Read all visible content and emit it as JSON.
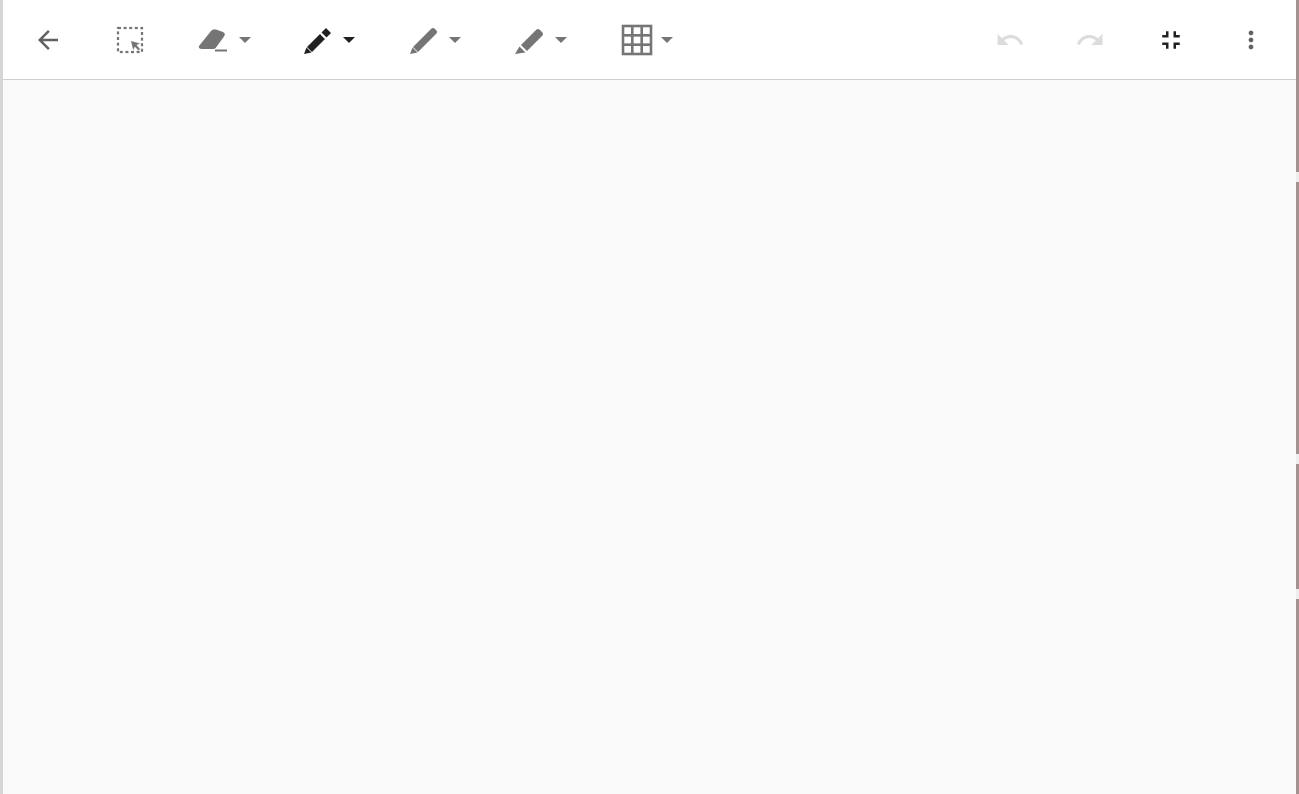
{
  "toolbar": {
    "tools": [
      {
        "name": "back-button",
        "icon": "arrow-left-icon",
        "has_dropdown": false,
        "enabled": true
      },
      {
        "name": "select-tool",
        "icon": "lasso-select-icon",
        "has_dropdown": false,
        "enabled": true
      },
      {
        "name": "eraser-tool",
        "icon": "eraser-icon",
        "has_dropdown": true,
        "enabled": true
      },
      {
        "name": "marker-tool",
        "icon": "marker-icon",
        "has_dropdown": true,
        "enabled": true,
        "active": true
      },
      {
        "name": "pen-tool",
        "icon": "pen-icon",
        "has_dropdown": true,
        "enabled": true
      },
      {
        "name": "highlighter-tool",
        "icon": "highlighter-icon",
        "has_dropdown": true,
        "enabled": true
      },
      {
        "name": "background-tool",
        "icon": "grid-icon",
        "has_dropdown": true,
        "enabled": true
      },
      {
        "name": "undo-button",
        "icon": "undo-icon",
        "has_dropdown": false,
        "enabled": false
      },
      {
        "name": "redo-button",
        "icon": "redo-icon",
        "has_dropdown": false,
        "enabled": false
      },
      {
        "name": "exit-fullscreen-button",
        "icon": "fullscreen-exit-icon",
        "has_dropdown": false,
        "enabled": true
      },
      {
        "name": "more-options-button",
        "icon": "more-vert-icon",
        "has_dropdown": false,
        "enabled": true
      }
    ]
  },
  "colors": {
    "toolbar_bg": "#ffffff",
    "canvas_bg": "#f9f9f9",
    "icon": "#757575",
    "icon_active": "#212121",
    "icon_disabled": "#dcdcdc"
  }
}
